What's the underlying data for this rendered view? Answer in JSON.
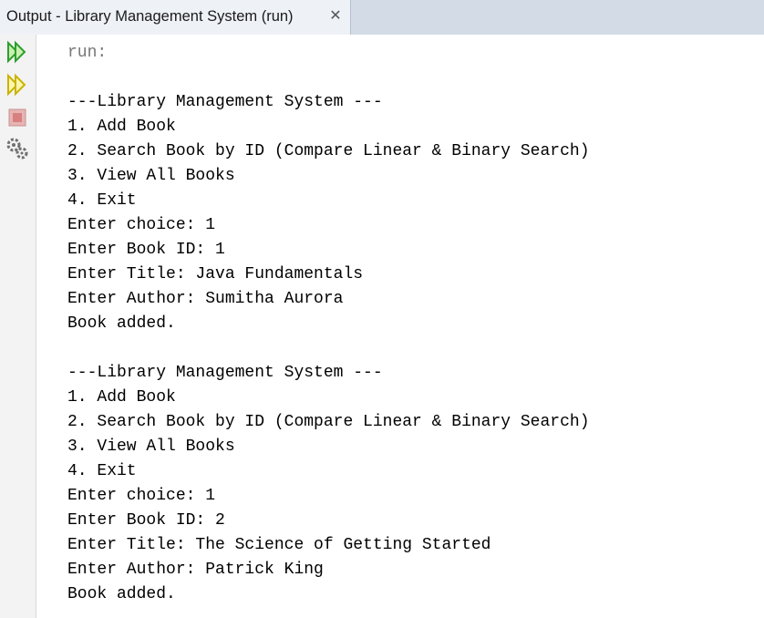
{
  "tab": {
    "title": "Output - Library Management System (run)",
    "close_glyph": "✕"
  },
  "toolbar": [
    {
      "name": "rerun-icon",
      "color": "#2e9e2e"
    },
    {
      "name": "rerun-with-options-icon",
      "color": "#c8b400"
    },
    {
      "name": "stop-icon",
      "color": "#d88080"
    },
    {
      "name": "settings-icon",
      "color": "#707070"
    }
  ],
  "console": {
    "lines": [
      "run:",
      "",
      "---Library Management System ---",
      "1. Add Book",
      "2. Search Book by ID (Compare Linear & Binary Search)",
      "3. View All Books",
      "4. Exit",
      "Enter choice: 1",
      "Enter Book ID: 1",
      "Enter Title: Java Fundamentals",
      "Enter Author: Sumitha Aurora",
      "Book added.",
      "",
      "---Library Management System ---",
      "1. Add Book",
      "2. Search Book by ID (Compare Linear & Binary Search)",
      "3. View All Books",
      "4. Exit",
      "Enter choice: 1",
      "Enter Book ID: 2",
      "Enter Title: The Science of Getting Started",
      "Enter Author: Patrick King",
      "Book added."
    ]
  }
}
